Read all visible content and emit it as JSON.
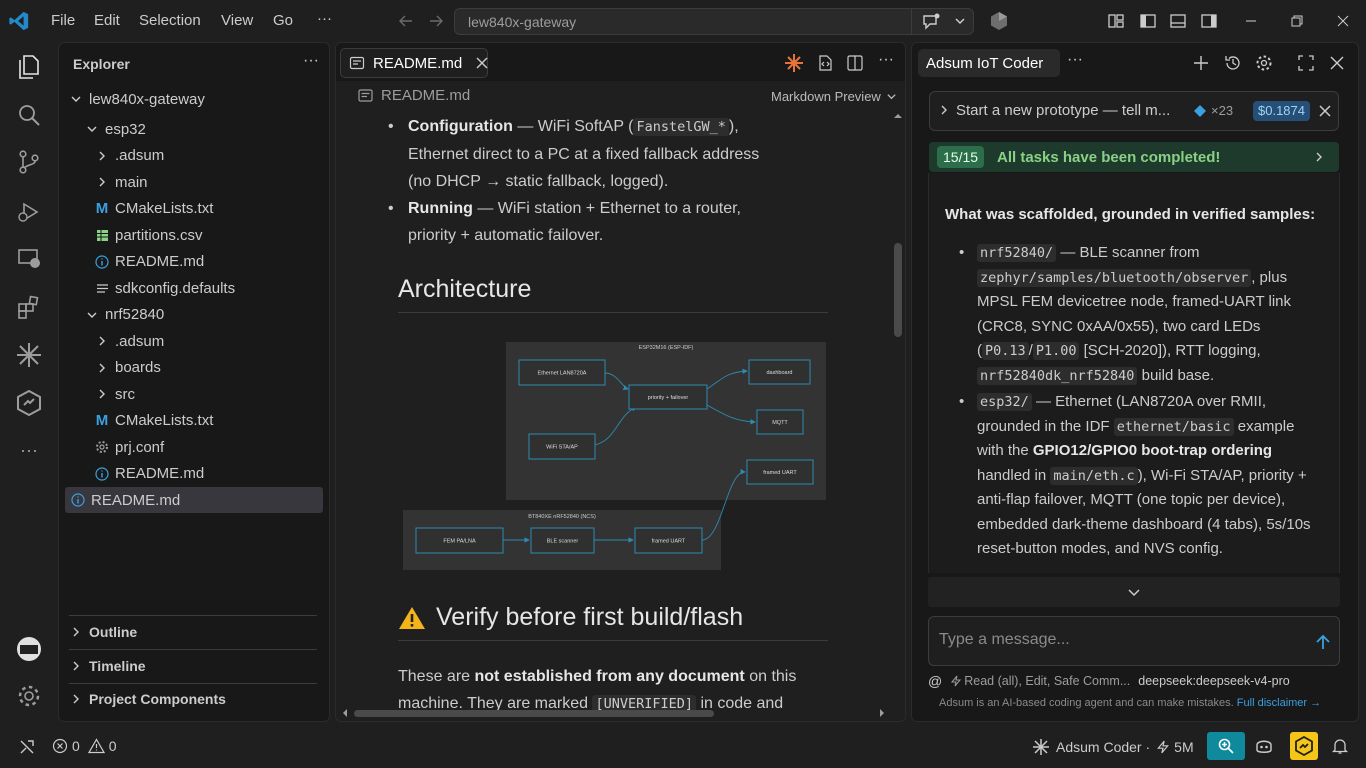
{
  "window": {
    "menu": [
      "File",
      "Edit",
      "Selection",
      "View",
      "Go"
    ],
    "more": "···",
    "search_text": "lew840x-gateway"
  },
  "explorer": {
    "title": "Explorer",
    "root": "lew840x-gateway",
    "items": [
      {
        "label": "esp32",
        "icon": "chevron-down",
        "depth": 1
      },
      {
        "label": ".adsum",
        "icon": "chevron-right",
        "depth": 2
      },
      {
        "label": "main",
        "icon": "chevron-right",
        "depth": 2
      },
      {
        "label": "CMakeLists.txt",
        "icon": "m-icon",
        "depth": 2
      },
      {
        "label": "partitions.csv",
        "icon": "table-icon",
        "depth": 2
      },
      {
        "label": "README.md",
        "icon": "info-icon",
        "depth": 2
      },
      {
        "label": "sdkconfig.defaults",
        "icon": "lines-icon",
        "depth": 2
      },
      {
        "label": "nrf52840",
        "icon": "chevron-down",
        "depth": 1
      },
      {
        "label": ".adsum",
        "icon": "chevron-right",
        "depth": 2
      },
      {
        "label": "boards",
        "icon": "chevron-right",
        "depth": 2
      },
      {
        "label": "src",
        "icon": "chevron-right",
        "depth": 2
      },
      {
        "label": "CMakeLists.txt",
        "icon": "m-icon",
        "depth": 2
      },
      {
        "label": "prj.conf",
        "icon": "gear-icon",
        "depth": 2
      },
      {
        "label": "README.md",
        "icon": "info-icon",
        "depth": 2
      },
      {
        "label": "README.md",
        "icon": "info-icon",
        "depth": 1
      }
    ],
    "sections": [
      "Outline",
      "Timeline",
      "Project Components"
    ]
  },
  "editor": {
    "tab_label": "README.md",
    "breadcrumb": "README.md",
    "preview_label": "Markdown Preview",
    "li1_bold": "Configuration",
    "li1_a": " — WiFi SoftAP (",
    "li1_code": "FanstelGW_*",
    "li1_b": "),",
    "li1_c": "Ethernet direct to a PC at a fixed fallback address",
    "li1_d": "(no DHCP → static fallback, logged).",
    "li2_bold": "Running",
    "li2_a": " — WiFi station + Ethernet to a router,",
    "li2_b": "priority + automatic failover.",
    "h2_arch": "Architecture",
    "h2_verify": "Verify before first build/flash",
    "warn_emoji": "⚠️",
    "p1_a": "These are ",
    "p1_bold": "not established from any document",
    "p1_b": " on this",
    "p2_a": "machine. They are marked ",
    "p2_code": "[UNVERIFIED]",
    "p2_b": " in code and",
    "diagram": {
      "top_title": "ESP32M16 (ESP-IDF)",
      "bottom_title": "BT840XE nRF52840 (NCS)",
      "eth": "Ethernet LAN8720A",
      "wifi": "WiFi STA/AP",
      "prio": "priority + failover",
      "dash": "dashboard",
      "mqtt": "MQTT",
      "fuart_top": "framed UART",
      "fem": "FEM PA/LNA",
      "ble": "BLE scanner",
      "fuart_bot": "framed UART"
    }
  },
  "chat": {
    "title": "Adsum IoT Coder",
    "prompt_banner": "Start a new prototype — tell m...",
    "count": "×23",
    "cost": "$0.1874",
    "tasks_badge": "15/15",
    "tasks_text": "All tasks have been completed!",
    "msg_heading": "What was scaffolded, grounded in verified samples:",
    "b1_code1": "nrf52840/",
    "b1_t1": " — BLE scanner from",
    "b1_code2": "zephyr/samples/bluetooth/observer",
    "b1_t2": ", plus",
    "b1_t3": "MPSL FEM devicetree node, framed-UART link (CRC8, SYNC 0xAA/0x55), two card LEDs (",
    "b1_code3": "P0.13",
    "b1_t4": "/",
    "b1_code4": "P1.00",
    "b1_t5": " [SCH-2020]), RTT logging,",
    "b1_code5": "nrf52840dk_nrf52840",
    "b1_t6": " build base.",
    "b2_code1": "esp32/",
    "b2_t1": " — Ethernet (LAN8720A over RMII, grounded in the IDF ",
    "b2_code2": "ethernet/basic",
    "b2_t2": " example with the ",
    "b2_bold": "GPIO12/GPIO0 boot-trap ordering",
    "b2_t3": " handled in ",
    "b2_code3": "main/eth.c",
    "b2_t4": "), Wi-Fi STA/AP, priority + anti-flap failover, MQTT (one topic per device), embedded dark-theme dashboard (4 tabs), 5s/10s reset-button modes, and NVS config.",
    "input_placeholder": "Type a message...",
    "perm_text": "Read (all), Edit, Safe Comm...",
    "model": "deepseek:deepseek-v4-pro",
    "disclaimer": "Adsum is an AI-based coding agent and can make mistakes.",
    "disclaimer_link": "Full disclaimer →"
  },
  "statusbar": {
    "errors": "0",
    "warnings": "0",
    "agent": "Adsum Coder ·",
    "tokens": "5M"
  },
  "colors": {
    "accent": "#0078d4",
    "teal": "#4ec9b0",
    "success_bg": "#1e3a2c",
    "success_text": "#89d185"
  }
}
